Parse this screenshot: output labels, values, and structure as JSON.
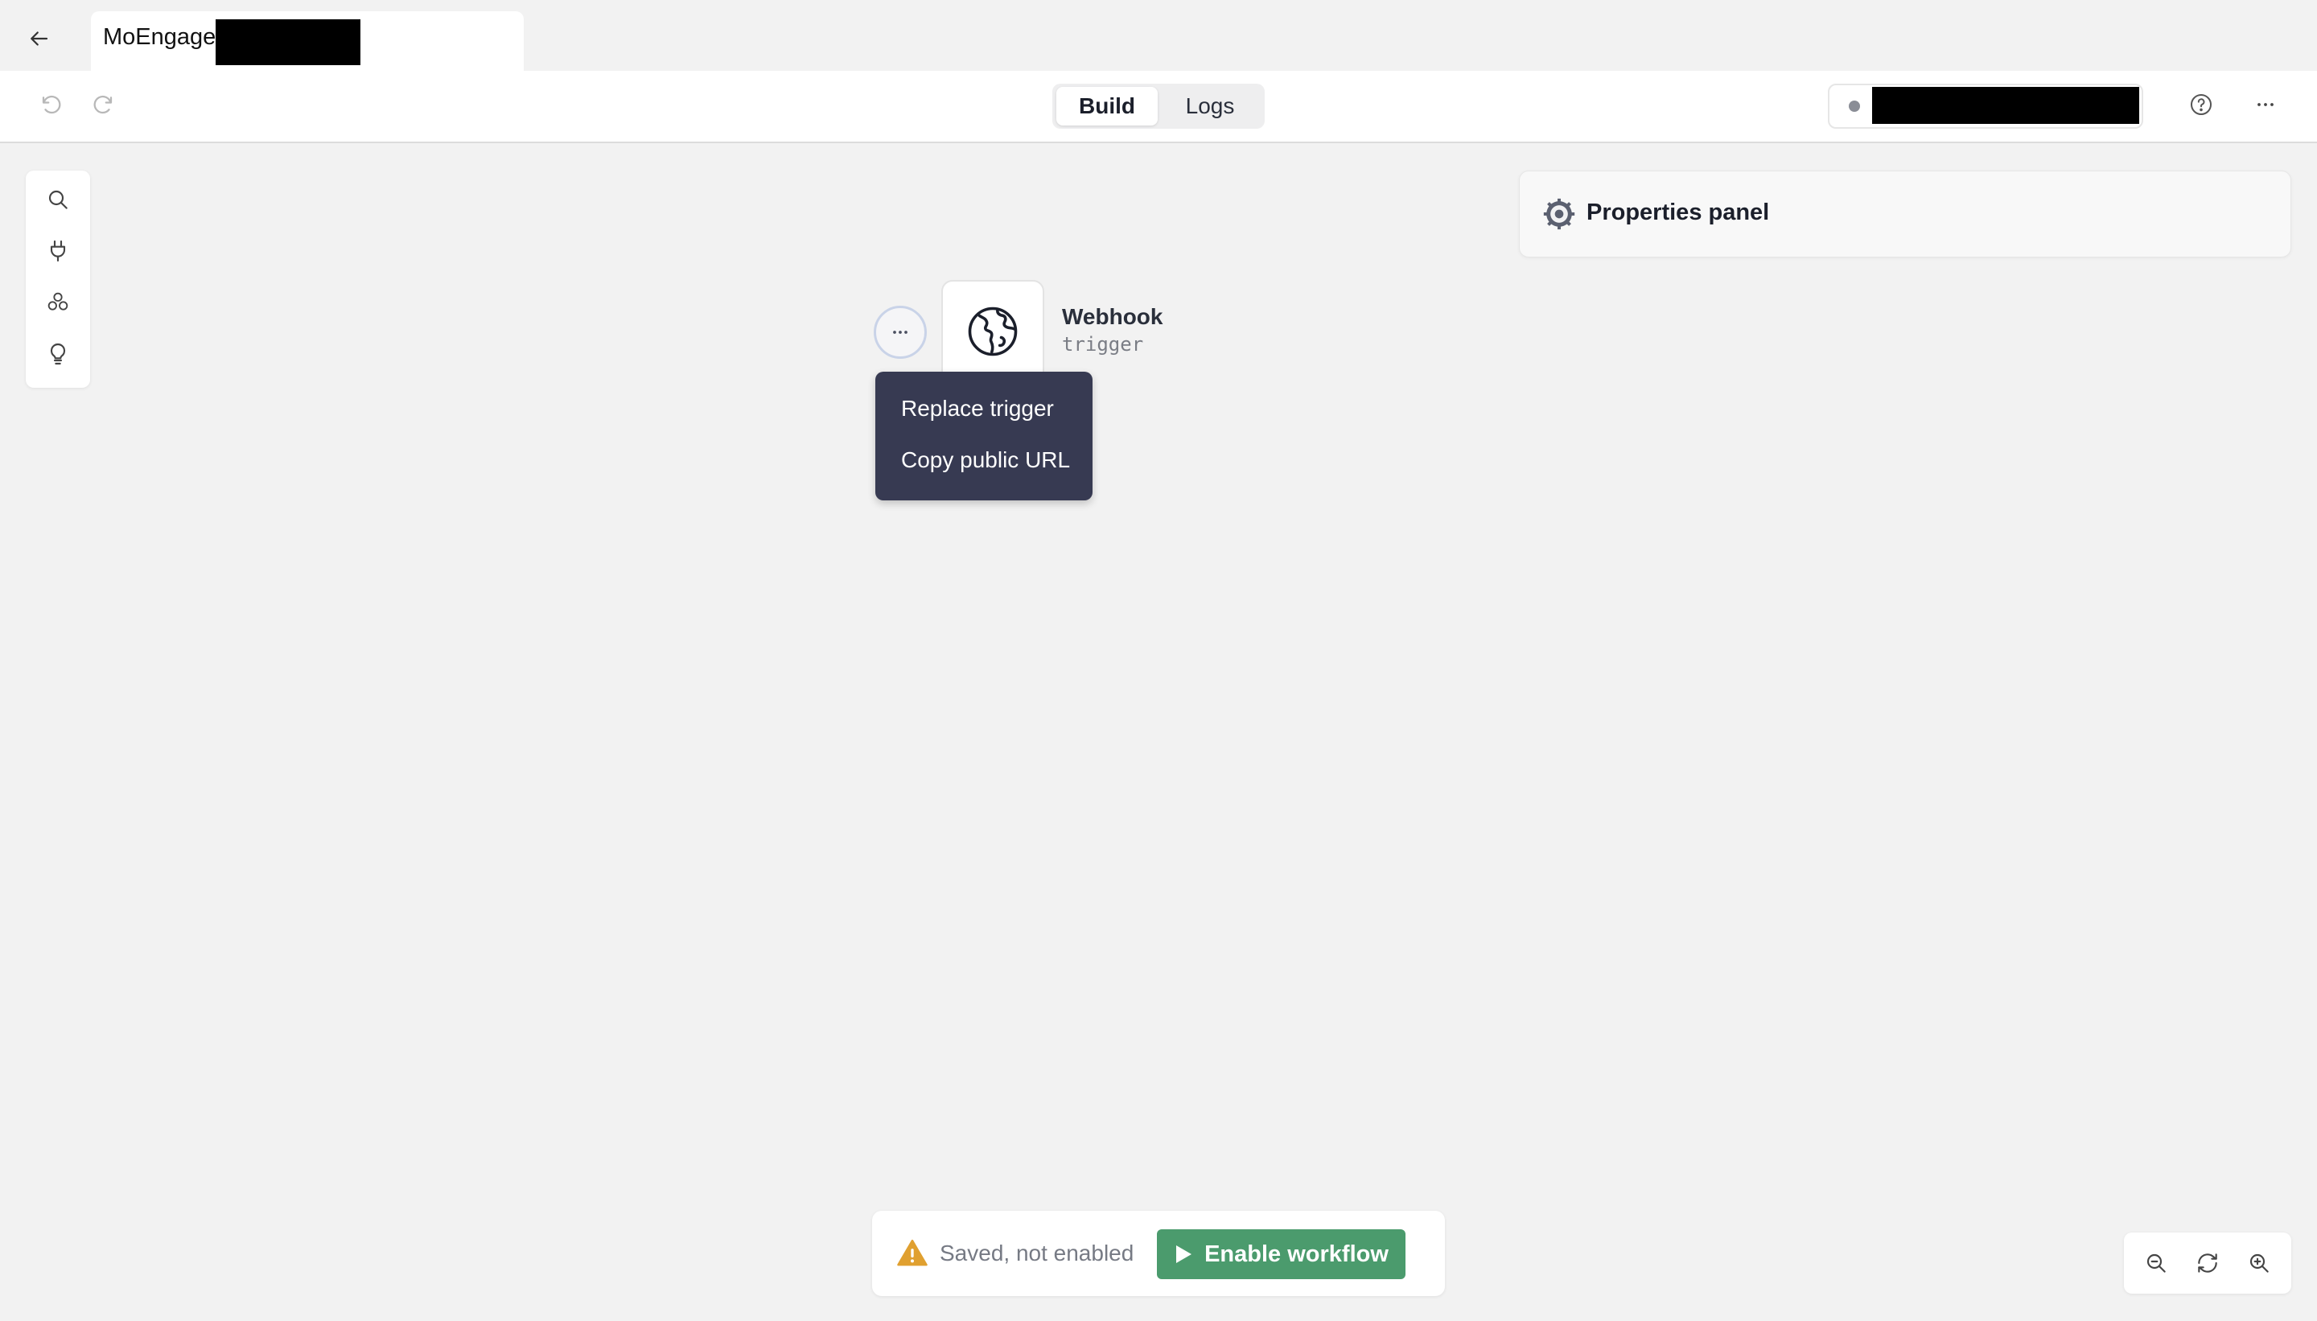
{
  "tab": {
    "title": "MoEngage"
  },
  "toolbar": {
    "tabs": [
      {
        "label": "Build",
        "active": true
      },
      {
        "label": "Logs",
        "active": false
      }
    ]
  },
  "left_tools": [
    "search-icon",
    "plug-icon",
    "integrations-icon",
    "lightbulb-icon"
  ],
  "properties_panel": {
    "title": "Properties panel"
  },
  "node": {
    "name": "Webhook",
    "type": "trigger"
  },
  "context_menu": {
    "items": [
      "Replace trigger",
      "Copy public URL"
    ]
  },
  "status": {
    "text": "Saved, not enabled",
    "button_label": "Enable workflow"
  },
  "colors": {
    "accent_green": "#4b9b6d",
    "menu_bg": "#373a52",
    "warning": "#e0a030",
    "canvas_bg": "#f2f2f2"
  }
}
